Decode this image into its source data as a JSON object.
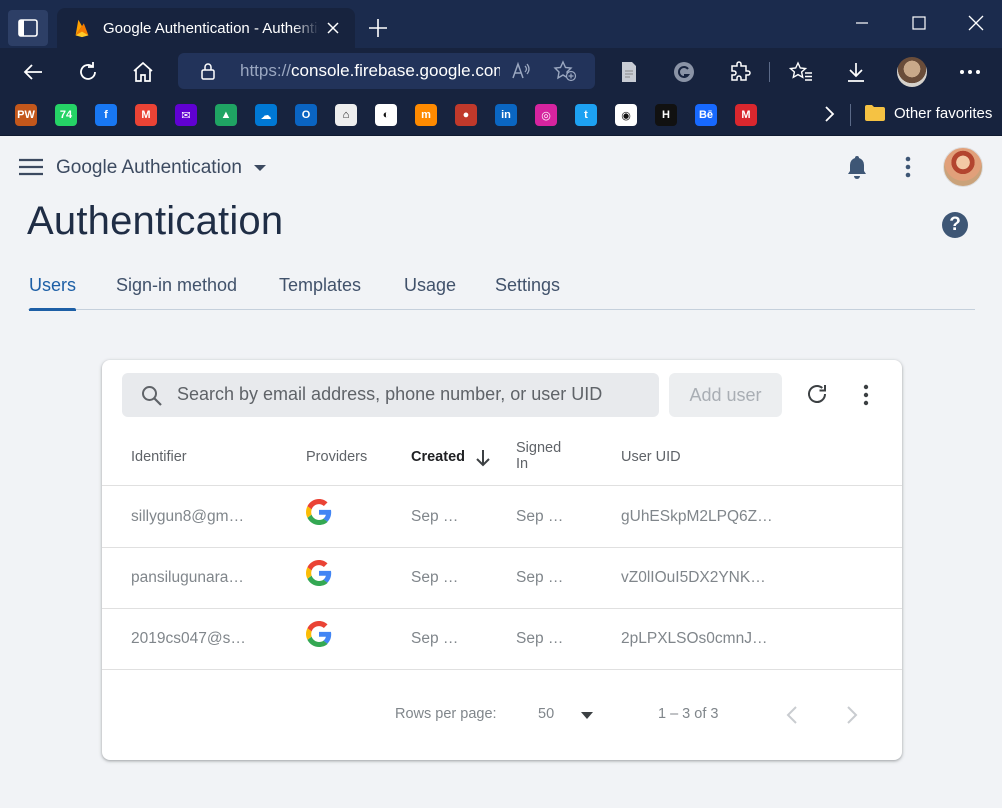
{
  "browser": {
    "tab_title": "Google Authentication - Authentication",
    "url_prefix": "https://",
    "url_host": "console.firebase.google.com",
    "bookmarks": [
      {
        "name": "bookmark-1",
        "icon": "pwa-icon",
        "color": "#c3571b",
        "glyph": "PW"
      },
      {
        "name": "bookmark-whatsapp",
        "icon": "whatsapp-icon",
        "color": "#25d366",
        "glyph": "74"
      },
      {
        "name": "bookmark-facebook",
        "icon": "facebook-icon",
        "color": "#1877f2",
        "glyph": "f"
      },
      {
        "name": "bookmark-gmail",
        "icon": "gmail-icon",
        "color": "#ea4335",
        "glyph": "M"
      },
      {
        "name": "bookmark-yahoo-mail",
        "icon": "mail-icon",
        "color": "#6001d2",
        "glyph": "✉"
      },
      {
        "name": "bookmark-drive",
        "icon": "drive-icon",
        "color": "#1fa463",
        "glyph": "▲"
      },
      {
        "name": "bookmark-onedrive",
        "icon": "cloud-icon",
        "color": "#0078d4",
        "glyph": "☁"
      },
      {
        "name": "bookmark-outlook",
        "icon": "outlook-icon",
        "color": "#0a64c2",
        "glyph": "O"
      },
      {
        "name": "bookmark-lms",
        "icon": "university-icon",
        "color": "#eeeeee",
        "glyph": "⌂"
      },
      {
        "name": "bookmark-circle",
        "icon": "circle-icon",
        "color": "#ffffff",
        "glyph": "◐"
      },
      {
        "name": "bookmark-medium",
        "icon": "medium-icon",
        "color": "#ff8a00",
        "glyph": "m"
      },
      {
        "name": "bookmark-red",
        "icon": "red-circle-icon",
        "color": "#c0392b",
        "glyph": "●"
      },
      {
        "name": "bookmark-linkedin",
        "icon": "linkedin-icon",
        "color": "#0a66c2",
        "glyph": "in"
      },
      {
        "name": "bookmark-instagram",
        "icon": "instagram-icon",
        "color": "#d6249f",
        "glyph": "◎"
      },
      {
        "name": "bookmark-twitter",
        "icon": "twitter-icon",
        "color": "#1da1f2",
        "glyph": "t"
      },
      {
        "name": "bookmark-github",
        "icon": "github-icon",
        "color": "#ffffff",
        "glyph": "◉"
      },
      {
        "name": "bookmark-hackerrank",
        "icon": "hackerrank-icon",
        "color": "#111111",
        "glyph": "H"
      },
      {
        "name": "bookmark-behance",
        "icon": "behance-icon",
        "color": "#1769ff",
        "glyph": "Bē"
      },
      {
        "name": "bookmark-mega",
        "icon": "mega-icon",
        "color": "#d9272e",
        "glyph": "M"
      }
    ],
    "other_favorites": "Other favorites"
  },
  "header": {
    "project_name": "Google Authentication",
    "page_title": "Authentication"
  },
  "tabs": [
    {
      "label": "Users",
      "active": true
    },
    {
      "label": "Sign-in method",
      "active": false
    },
    {
      "label": "Templates",
      "active": false
    },
    {
      "label": "Usage",
      "active": false
    },
    {
      "label": "Settings",
      "active": false
    }
  ],
  "users_table": {
    "search_placeholder": "Search by email address, phone number, or user UID",
    "add_user_label": "Add user",
    "columns": {
      "identifier": "Identifier",
      "providers": "Providers",
      "created": "Created",
      "signed_in_line1": "Signed",
      "signed_in_line2": "In",
      "user_uid": "User UID"
    },
    "rows": [
      {
        "identifier": "sillygun8@gm…",
        "provider": "google-icon",
        "created": "Sep …",
        "signed_in": "Sep …",
        "uid": "gUhESkpM2LPQ6Z…"
      },
      {
        "identifier": "pansilugunara…",
        "provider": "google-icon",
        "created": "Sep …",
        "signed_in": "Sep …",
        "uid": "vZ0lIOuI5DX2YNK…"
      },
      {
        "identifier": "2019cs047@s…",
        "provider": "google-icon",
        "created": "Sep …",
        "signed_in": "Sep …",
        "uid": "2pLPXLSOs0cmnJ…"
      }
    ],
    "pagination": {
      "rows_per_page_label": "Rows per page:",
      "rows_per_page_value": "50",
      "range": "1 – 3 of 3"
    }
  },
  "colors": {
    "chrome_dark": "#17233e",
    "accent": "#1d5fa6",
    "page_bg": "#f1f3f6"
  }
}
